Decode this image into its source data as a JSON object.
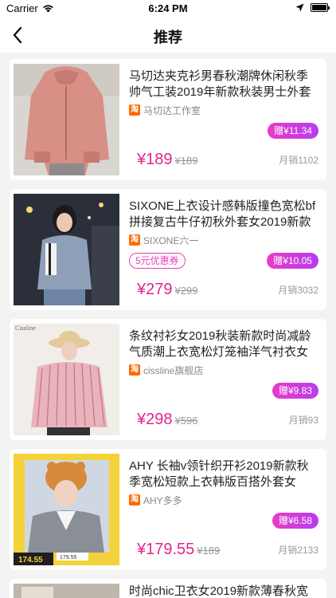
{
  "status": {
    "carrier": "Carrier",
    "time": "6:24 PM"
  },
  "nav": {
    "title": "推荐"
  },
  "products": [
    {
      "title": "马切达夹克衫男春秋潮牌休闲秋季帅气工装2019年新款秋装男士外套",
      "shop": "马切达工作室",
      "coupon": "",
      "gift": "赠¥11.34",
      "price": "¥189",
      "old_price": "¥189",
      "sales": "月销1102"
    },
    {
      "title": "SIXONE上衣设计感韩版撞色宽松bf拼接复古牛仔初秋外套女2019新款",
      "shop": "SIXONE六一",
      "coupon": "5元优惠券",
      "gift": "赠¥10.05",
      "price": "¥279",
      "old_price": "¥299",
      "sales": "月销3032"
    },
    {
      "title": "条纹衬衫女2019秋装新款时尚减龄气质潮上衣宽松灯笼袖洋气衬衣女",
      "shop": "cissline旗舰店",
      "coupon": "",
      "gift": "赠¥9.83",
      "price": "¥298",
      "old_price": "¥596",
      "sales": "月销93",
      "image_text": "Cissline"
    },
    {
      "title": "AHY 长袖v领针织开衫2019新款秋季宽松短款上衣韩版百搭外套女",
      "shop": "AHY多多",
      "coupon": "",
      "gift": "赠¥6.58",
      "price": "¥179.55",
      "old_price": "¥189",
      "sales": "月销2133",
      "image_text": [
        "174.55",
        "179.55"
      ]
    },
    {
      "title": "时尚chic卫衣女2019新款薄春秋宽",
      "shop": "",
      "coupon": "",
      "gift": "",
      "price": "",
      "old_price": "",
      "sales": ""
    }
  ],
  "taobao_glyph": "淘",
  "colors": {
    "accent": "#e2258f",
    "gift_gradient": [
      "#e93bc7",
      "#b83cf0"
    ],
    "shop_icon": "#ff6a00"
  }
}
